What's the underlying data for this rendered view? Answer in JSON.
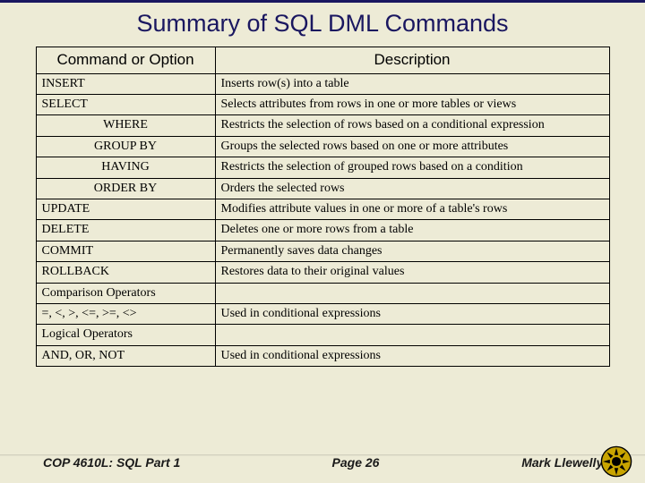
{
  "title": "Summary of SQL DML Commands",
  "headers": {
    "cmd": "Command or Option",
    "desc": "Description"
  },
  "rows": [
    {
      "cmd": "INSERT",
      "desc": "Inserts row(s) into a table",
      "cls": "cmd-left"
    },
    {
      "cmd": "SELECT",
      "desc": "Selects attributes from rows in one or more tables or views",
      "cls": "cmd-left"
    },
    {
      "cmd": "WHERE",
      "desc": "Restricts the selection of rows based on a conditional expression",
      "cls": "cmd-center"
    },
    {
      "cmd": "GROUP BY",
      "desc": "Groups the selected rows based on one or more attributes",
      "cls": "cmd-center"
    },
    {
      "cmd": "HAVING",
      "desc": "Restricts the selection of grouped rows based on a condition",
      "cls": "cmd-center"
    },
    {
      "cmd": "ORDER BY",
      "desc": "Orders the selected rows",
      "cls": "cmd-center"
    },
    {
      "cmd": "UPDATE",
      "desc": "Modifies attribute values in one or more of a table's rows",
      "cls": "cmd-left"
    },
    {
      "cmd": "DELETE",
      "desc": "Deletes one or more rows from a table",
      "cls": "cmd-left"
    },
    {
      "cmd": "COMMIT",
      "desc": "Permanently saves data changes",
      "cls": "cmd-left"
    },
    {
      "cmd": "ROLLBACK",
      "desc": "Restores data to their original values",
      "cls": "cmd-left"
    },
    {
      "cmd": "Comparison Operators",
      "desc": "",
      "cls": "section"
    },
    {
      "cmd": "=, <, >, <=, >=, <>",
      "desc": "Used in conditional expressions",
      "cls": "cmd-left"
    },
    {
      "cmd": "Logical Operators",
      "desc": "",
      "cls": "section"
    },
    {
      "cmd": "AND, OR, NOT",
      "desc": "Used in conditional expressions",
      "cls": "cmd-left"
    }
  ],
  "footer": {
    "left": "COP 4610L: SQL Part 1",
    "center": "Page 26",
    "right": "Mark Llewellyn ©"
  },
  "chart_data": {
    "type": "table",
    "title": "Summary of SQL DML Commands",
    "columns": [
      "Command or Option",
      "Description"
    ],
    "rows": [
      [
        "INSERT",
        "Inserts row(s) into a table"
      ],
      [
        "SELECT",
        "Selects attributes from rows in one or more tables or views"
      ],
      [
        "WHERE",
        "Restricts the selection of rows based on a conditional expression"
      ],
      [
        "GROUP BY",
        "Groups the selected rows based on one or more attributes"
      ],
      [
        "HAVING",
        "Restricts the selection of grouped rows based on a condition"
      ],
      [
        "ORDER BY",
        "Orders the selected rows"
      ],
      [
        "UPDATE",
        "Modifies attribute values in one or more of a table's rows"
      ],
      [
        "DELETE",
        "Deletes one or more rows from a table"
      ],
      [
        "COMMIT",
        "Permanently saves data changes"
      ],
      [
        "ROLLBACK",
        "Restores data to their original values"
      ],
      [
        "Comparison Operators",
        ""
      ],
      [
        "=, <, >, <=, >=, <>",
        "Used in conditional expressions"
      ],
      [
        "Logical Operators",
        ""
      ],
      [
        "AND, OR, NOT",
        "Used in conditional expressions"
      ]
    ]
  }
}
